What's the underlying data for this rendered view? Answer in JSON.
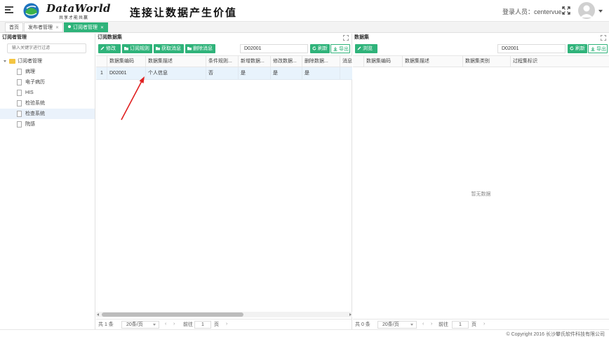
{
  "header": {
    "brand_name": "DataWorld",
    "brand_tagline": "共享才能共赢",
    "slogan": "连接让数据产生价值",
    "login_user": "登录人员：centervue"
  },
  "tabs": [
    {
      "label": "首页"
    },
    {
      "label": "发布者管理"
    },
    {
      "label": "订阅者管理"
    }
  ],
  "left_panel": {
    "title": "订阅者管理",
    "filter_placeholder": "输入关键字进行过滤",
    "tree_root": "订阅者管理",
    "tree_items": [
      {
        "label": "病理"
      },
      {
        "label": "电子病历"
      },
      {
        "label": "HIS"
      },
      {
        "label": "检验系统"
      },
      {
        "label": "检查系统"
      },
      {
        "label": "院感"
      }
    ],
    "selected_item": "检查系统"
  },
  "subscription_panel": {
    "title": "订阅数据集",
    "buttons": {
      "edit": "修改",
      "subscribe_rule": "订阅规则",
      "get_message": "获取消息",
      "delete_message": "删除消息",
      "refresh": "刷新",
      "export": "导出"
    },
    "search_value": "D02001",
    "columns": [
      "数据集编码",
      "数据集描述",
      "条件规则...",
      "新增数据...",
      "修改数据...",
      "删除数据...",
      "消息"
    ],
    "rows": [
      {
        "index": "1",
        "code": "D02001",
        "desc": "个人信息",
        "rule": "否",
        "add": "是",
        "modify": "是",
        "delete": "是",
        "msg": ""
      }
    ],
    "pager": {
      "total": "共 1 条",
      "page_size": "20条/页",
      "goto_label": "前往",
      "page": "1",
      "page_unit": "页"
    }
  },
  "dataset_panel": {
    "title": "数据集",
    "buttons": {
      "browse": "浏览",
      "refresh": "刷新",
      "export": "导出"
    },
    "search_value": "D02001",
    "columns": [
      "数据集编码",
      "数据集描述",
      "数据集类别",
      "过程集标识"
    ],
    "empty_text": "暂无数据",
    "pager": {
      "total": "共 0 条",
      "page_size": "20条/页",
      "goto_label": "前往",
      "page": "1",
      "page_unit": "页"
    }
  },
  "footer": {
    "copyright": "© Copyright 2016 长沙攀氏软件科技有限公司"
  },
  "colors": {
    "accent": "#2fb37a",
    "row_highlight": "#e8f3fc",
    "annotation": "#e02020"
  }
}
